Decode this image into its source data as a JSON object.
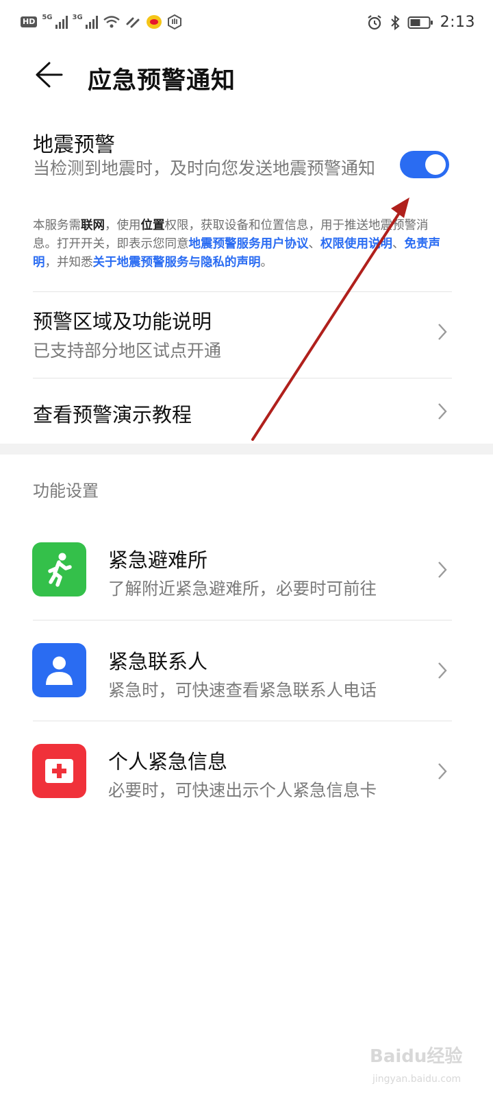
{
  "status_bar": {
    "hd": "HD",
    "net1": "5G",
    "net2": "3G",
    "time": "2:13"
  },
  "header": {
    "title": "应急预警通知"
  },
  "earthquake": {
    "title": "地震预警",
    "description": "当检测到地震时，及时向您发送地震预警通知",
    "toggle_on": true,
    "notice": {
      "t1": "本服务需",
      "b1": "联网",
      "t2": "，使用",
      "b2": "位置",
      "t3": "权限，获取设备和位置信息，用于推送地震预警消息。打开开关，即表示您同意",
      "l1": "地震预警服务用户协议",
      "t4": "、",
      "l2": "权限使用说明",
      "t5": "、",
      "l3": "免责声明",
      "t6": "，并知悉",
      "l4": "关于地震预警服务与隐私的声明",
      "t7": "。"
    }
  },
  "rows": [
    {
      "title": "预警区域及功能说明",
      "subtitle": "已支持部分地区试点开通"
    },
    {
      "title": "查看预警演示教程"
    }
  ],
  "features": {
    "header": "功能设置",
    "items": [
      {
        "title": "紧急避难所",
        "subtitle": "了解附近紧急避难所，必要时可前往",
        "icon": "running-person-icon",
        "color": "#34c04a"
      },
      {
        "title": "紧急联系人",
        "subtitle": "紧急时，可快速查看紧急联系人电话",
        "icon": "person-icon",
        "color": "#2a6cf2"
      },
      {
        "title": "个人紧急信息",
        "subtitle": "必要时，可快速出示个人紧急信息卡",
        "icon": "medical-cross-icon",
        "color": "#f0313a"
      }
    ]
  },
  "watermark": {
    "text": "Baidu经验",
    "url": "jingyan.baidu.com"
  }
}
